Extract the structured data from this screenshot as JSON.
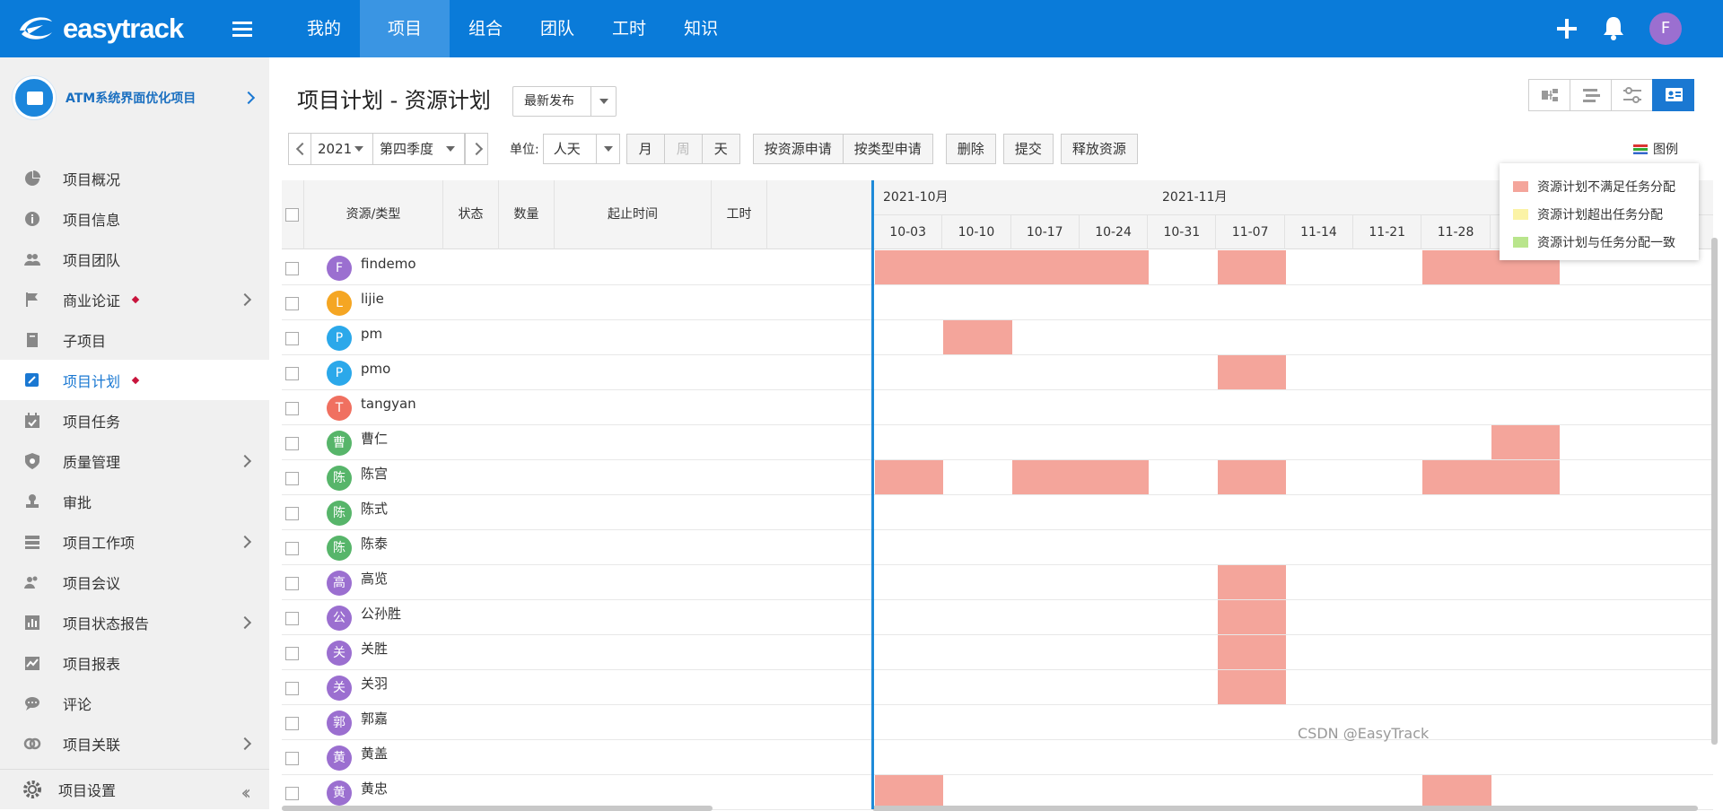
{
  "topbar": {
    "logo_text": "easytrack",
    "nav": [
      "我的",
      "项目",
      "组合",
      "团队",
      "工时",
      "知识"
    ],
    "active_nav": 1,
    "user_initial": "F"
  },
  "sidebar": {
    "project_name": "ATM系统界面优化项目",
    "items": [
      {
        "label": "项目概况",
        "icon": "pie-chart-icon",
        "chev": false,
        "dot": false
      },
      {
        "label": "项目信息",
        "icon": "info-icon",
        "chev": false,
        "dot": false
      },
      {
        "label": "项目团队",
        "icon": "team-icon",
        "chev": false,
        "dot": false
      },
      {
        "label": "商业论证",
        "icon": "flag-icon",
        "chev": true,
        "dot": true
      },
      {
        "label": "子项目",
        "icon": "book-icon",
        "chev": false,
        "dot": false
      },
      {
        "label": "项目计划",
        "icon": "edit-plan-icon",
        "chev": false,
        "dot": true,
        "active": true
      },
      {
        "label": "项目任务",
        "icon": "calendar-check-icon",
        "chev": false,
        "dot": false
      },
      {
        "label": "质量管理",
        "icon": "shield-icon",
        "chev": true,
        "dot": false
      },
      {
        "label": "审批",
        "icon": "stamp-icon",
        "chev": false,
        "dot": false
      },
      {
        "label": "项目工作项",
        "icon": "list-icon",
        "chev": true,
        "dot": false
      },
      {
        "label": "项目会议",
        "icon": "meeting-icon",
        "chev": false,
        "dot": false
      },
      {
        "label": "项目状态报告",
        "icon": "bar-report-icon",
        "chev": true,
        "dot": false
      },
      {
        "label": "项目报表",
        "icon": "chart-report-icon",
        "chev": false,
        "dot": false
      },
      {
        "label": "评论",
        "icon": "comment-icon",
        "chev": false,
        "dot": false
      },
      {
        "label": "项目关联",
        "icon": "link-icon",
        "chev": true,
        "dot": false
      }
    ],
    "settings_label": "项目设置"
  },
  "page": {
    "title": "项目计划 - 资源计划",
    "release_select": "最新发布"
  },
  "toolbar": {
    "year": "2021",
    "quarter": "第四季度",
    "unit_label": "单位:",
    "unit_value": "人天",
    "period_buttons": [
      "月",
      "周",
      "天"
    ],
    "apply_by_resource": "按资源申请",
    "apply_by_type": "按类型申请",
    "delete": "删除",
    "submit": "提交",
    "release": "释放资源",
    "legend_link": "图例"
  },
  "legend": [
    {
      "label": "资源计划不满足任务分配",
      "color": "#f4a59b"
    },
    {
      "label": "资源计划超出任务分配",
      "color": "#fbf3a6"
    },
    {
      "label": "资源计划与任务分配一致",
      "color": "#b9e58c"
    }
  ],
  "table": {
    "headers": [
      "资源/类型",
      "状态",
      "数量",
      "起止时间",
      "工时"
    ],
    "months": [
      "2021-10月",
      "2021-11月"
    ],
    "weeks": [
      "10-03",
      "10-10",
      "10-17",
      "10-24",
      "10-31",
      "11-07",
      "11-14",
      "11-21",
      "11-28"
    ],
    "rows": [
      {
        "name": "findemo",
        "initial": "F",
        "color": "#9b6fd0",
        "bars": [
          [
            0,
            4
          ],
          [
            5,
            1
          ],
          [
            8,
            2
          ]
        ]
      },
      {
        "name": "lijie",
        "initial": "L",
        "color": "#f5a623",
        "bars": []
      },
      {
        "name": "pm",
        "initial": "P",
        "color": "#2ba8ea",
        "bars": [
          [
            1,
            1
          ]
        ]
      },
      {
        "name": "pmo",
        "initial": "P",
        "color": "#2ba8ea",
        "bars": [
          [
            5,
            1
          ]
        ]
      },
      {
        "name": "tangyan",
        "initial": "T",
        "color": "#f07060",
        "bars": []
      },
      {
        "name": "曹仁",
        "initial": "曹",
        "color": "#57b56a",
        "bars": [
          [
            9,
            1
          ]
        ]
      },
      {
        "name": "陈宫",
        "initial": "陈",
        "color": "#57b56a",
        "bars": [
          [
            0,
            1
          ],
          [
            2,
            2
          ],
          [
            5,
            1
          ],
          [
            8,
            2
          ]
        ]
      },
      {
        "name": "陈式",
        "initial": "陈",
        "color": "#57b56a",
        "bars": []
      },
      {
        "name": "陈泰",
        "initial": "陈",
        "color": "#57b56a",
        "bars": []
      },
      {
        "name": "高览",
        "initial": "高",
        "color": "#9b6fd0",
        "bars": [
          [
            5,
            1
          ]
        ]
      },
      {
        "name": "公孙胜",
        "initial": "公",
        "color": "#9b6fd0",
        "bars": [
          [
            5,
            1
          ]
        ]
      },
      {
        "name": "关胜",
        "initial": "关",
        "color": "#9b6fd0",
        "bars": [
          [
            5,
            1
          ]
        ]
      },
      {
        "name": "关羽",
        "initial": "关",
        "color": "#9b6fd0",
        "bars": [
          [
            5,
            1
          ]
        ]
      },
      {
        "name": "郭嘉",
        "initial": "郭",
        "color": "#9b6fd0",
        "bars": []
      },
      {
        "name": "黄盖",
        "initial": "黄",
        "color": "#9b6fd0",
        "bars": []
      },
      {
        "name": "黄忠",
        "initial": "黄",
        "color": "#9b6fd0",
        "bars": [
          [
            0,
            1
          ],
          [
            8,
            1
          ]
        ]
      }
    ]
  },
  "watermark": "CSDN @EasyTrack"
}
